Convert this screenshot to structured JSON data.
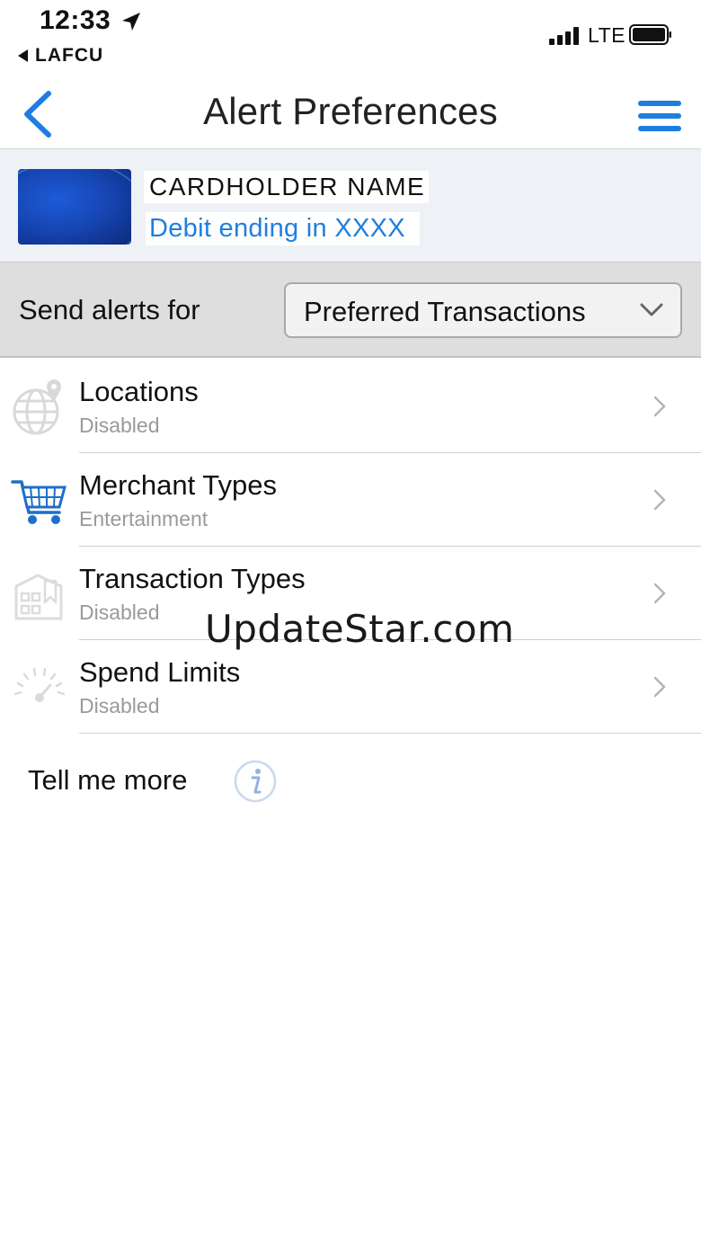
{
  "status_bar": {
    "time": "12:33",
    "back_app": "LAFCU",
    "network": "LTE"
  },
  "nav": {
    "title": "Alert Preferences"
  },
  "card": {
    "holder_name": "CARDHOLDER NAME",
    "subtitle": "Debit ending in XXXX"
  },
  "send_alerts": {
    "label": "Send alerts for",
    "selected": "Preferred Transactions"
  },
  "items": [
    {
      "title": "Locations",
      "status": "Disabled",
      "icon": "globe-pin-icon"
    },
    {
      "title": "Merchant Types",
      "status": "Entertainment",
      "icon": "shopping-cart-icon"
    },
    {
      "title": "Transaction Types",
      "status": "Disabled",
      "icon": "storefront-icon"
    },
    {
      "title": "Spend Limits",
      "status": "Disabled",
      "icon": "speedometer-icon"
    }
  ],
  "tell_me_more": "Tell me more",
  "watermark": "UpdateStar.com",
  "colors": {
    "accent_blue": "#1e7ee0",
    "header_bg": "#eef1f6",
    "select_row_bg": "#dedede",
    "muted_text": "#9a9a9a"
  }
}
